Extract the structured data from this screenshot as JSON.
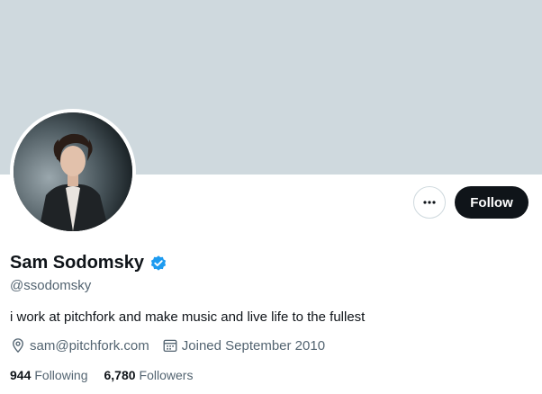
{
  "profile": {
    "display_name": "Sam Sodomsky",
    "handle": "@ssodomsky",
    "bio": "i work at pitchfork and make music and live life to the fullest",
    "website": "sam@pitchfork.com",
    "joined": "Joined September 2010",
    "verified_icon": "verified-badge-icon"
  },
  "stats": {
    "following_count": "944",
    "following_label": "Following",
    "followers_count": "6,780",
    "followers_label": "Followers"
  },
  "actions": {
    "follow_label": "Follow",
    "more_label": "···"
  },
  "colors": {
    "banner": "#cfd9de",
    "verified": "#1d9bf0",
    "primary_button": "#0f1419",
    "secondary_text": "#536471"
  }
}
